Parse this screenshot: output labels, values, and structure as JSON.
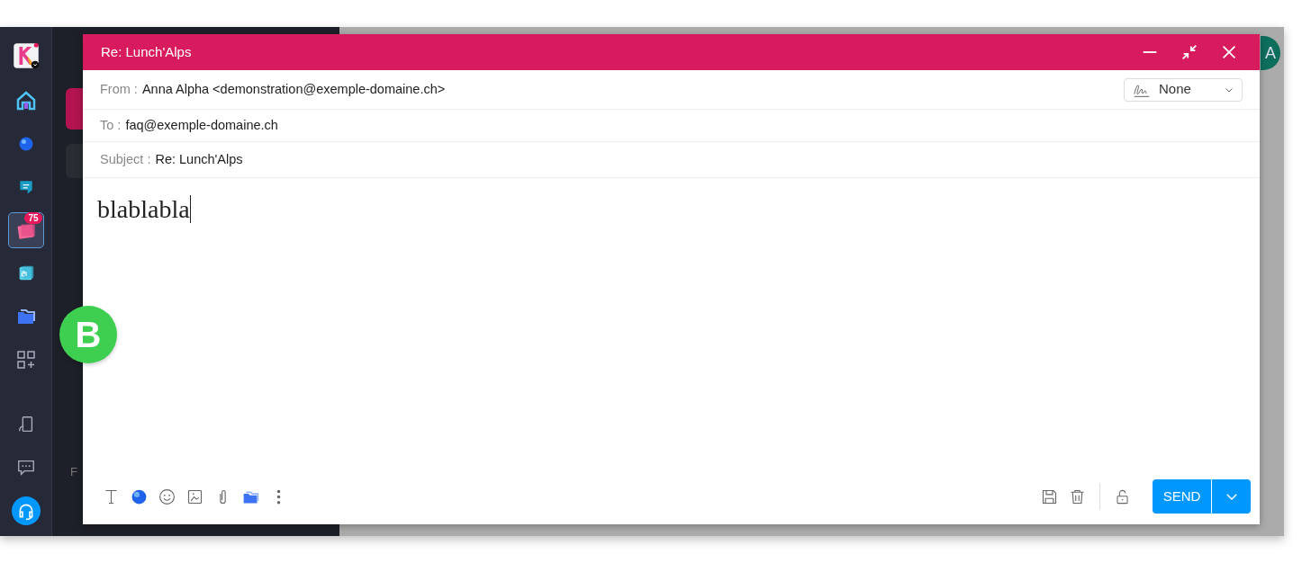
{
  "app_rail": {
    "items": [
      {
        "kind": "logo",
        "selected": false
      },
      {
        "kind": "home",
        "selected": false
      },
      {
        "kind": "sphere",
        "selected": false
      },
      {
        "kind": "chat-app",
        "selected": false
      },
      {
        "kind": "mail",
        "selected": true,
        "badge": "75"
      },
      {
        "kind": "calendar",
        "selected": false
      },
      {
        "kind": "drive",
        "selected": false
      },
      {
        "kind": "apps",
        "selected": false
      },
      {
        "kind": "device",
        "selected": false
      },
      {
        "kind": "feedback",
        "selected": false
      },
      {
        "kind": "support",
        "selected": false
      }
    ]
  },
  "folder_panel": {
    "partial_heading": "F"
  },
  "avatar": "A",
  "compose": {
    "title": "Re: Lunch'Alps",
    "from_label": "From :",
    "from_value": "Anna Alpha  <demonstration@exemple-domaine.ch>",
    "signature": "None",
    "to_label": "To :",
    "to_value": "faq@exemple-domaine.ch",
    "subject_label": "Subject :",
    "subject_value": "Re: Lunch'Alps",
    "body": "blablabla",
    "send": "SEND"
  },
  "marker": "B"
}
